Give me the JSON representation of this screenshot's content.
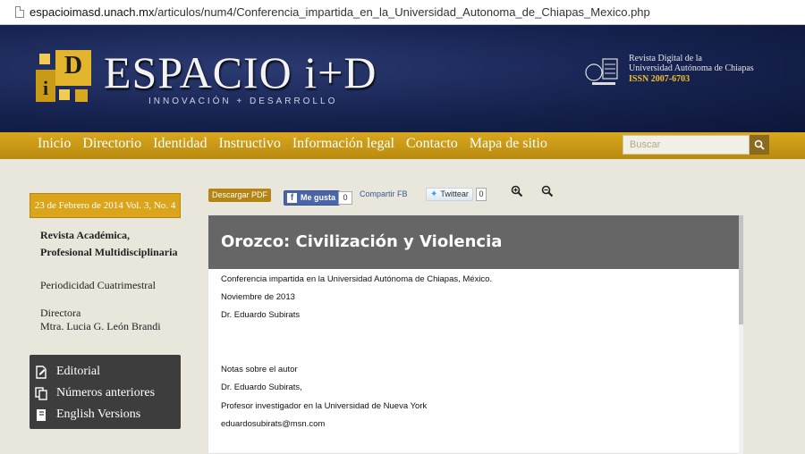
{
  "browser": {
    "url_domain": "espacioimasd.unach.mx",
    "url_path": "/articulos/num4/Conferencia_impartida_en_la_Universidad_Autonoma_de_Chiapas_Mexico.php"
  },
  "header": {
    "brand": "ESPACIO i+D",
    "tagline": "INNOVACIÓN + DESARROLLO",
    "logo_big_letter": "D",
    "logo_small_letter": "i",
    "journal_line1": "Revista Digital de la",
    "journal_line2": "Universidad Autónoma de Chiapas",
    "issn": "ISSN 2007-6703"
  },
  "nav": {
    "items": [
      "Inicio",
      "Directorio",
      "Identidad",
      "Instructivo",
      "Información legal",
      "Contacto",
      "Mapa de sitio"
    ],
    "search_placeholder": "Buscar"
  },
  "sidebar": {
    "date": "23 de Febrero de 2014 Vol. 3, No. 4",
    "type_line1": "Revista Académica,",
    "type_line2": "Profesional Multidisciplinaria",
    "periodicity": "Periodicidad Cuatrimestral",
    "director_label": "Directora",
    "director_name": "Mtra. Lucia G. León Brandi",
    "menu": [
      {
        "label": "Editorial",
        "icon": "editorial-icon"
      },
      {
        "label": "Números anteriores",
        "icon": "copy-icon"
      },
      {
        "label": "English Versions",
        "icon": "book-icon"
      }
    ]
  },
  "actions": {
    "pdf_label": "Descargar PDF",
    "fb_like_label": "Me gusta",
    "fb_like_count": "0",
    "fb_share_label": "Compartir FB",
    "twitter_label": "Twittear",
    "twitter_count": "0"
  },
  "article": {
    "title": "Orozco: Civilización y Violencia",
    "lines": [
      "Conferencia impartida en la Universidad Autónoma de Chiapas, México.",
      "Noviembre de 2013",
      "Dr. Eduardo Subirats",
      "Notas sobre el autor",
      "Dr. Eduardo Subirats,",
      "Profesor investigador en la Universidad de Nueva York",
      "eduardosubirats@msn.com"
    ]
  },
  "colors": {
    "header_bg": "#16224f",
    "gold": "#d9a81d",
    "title_bar": "#666666",
    "menu_bg": "#3d3d3d"
  }
}
